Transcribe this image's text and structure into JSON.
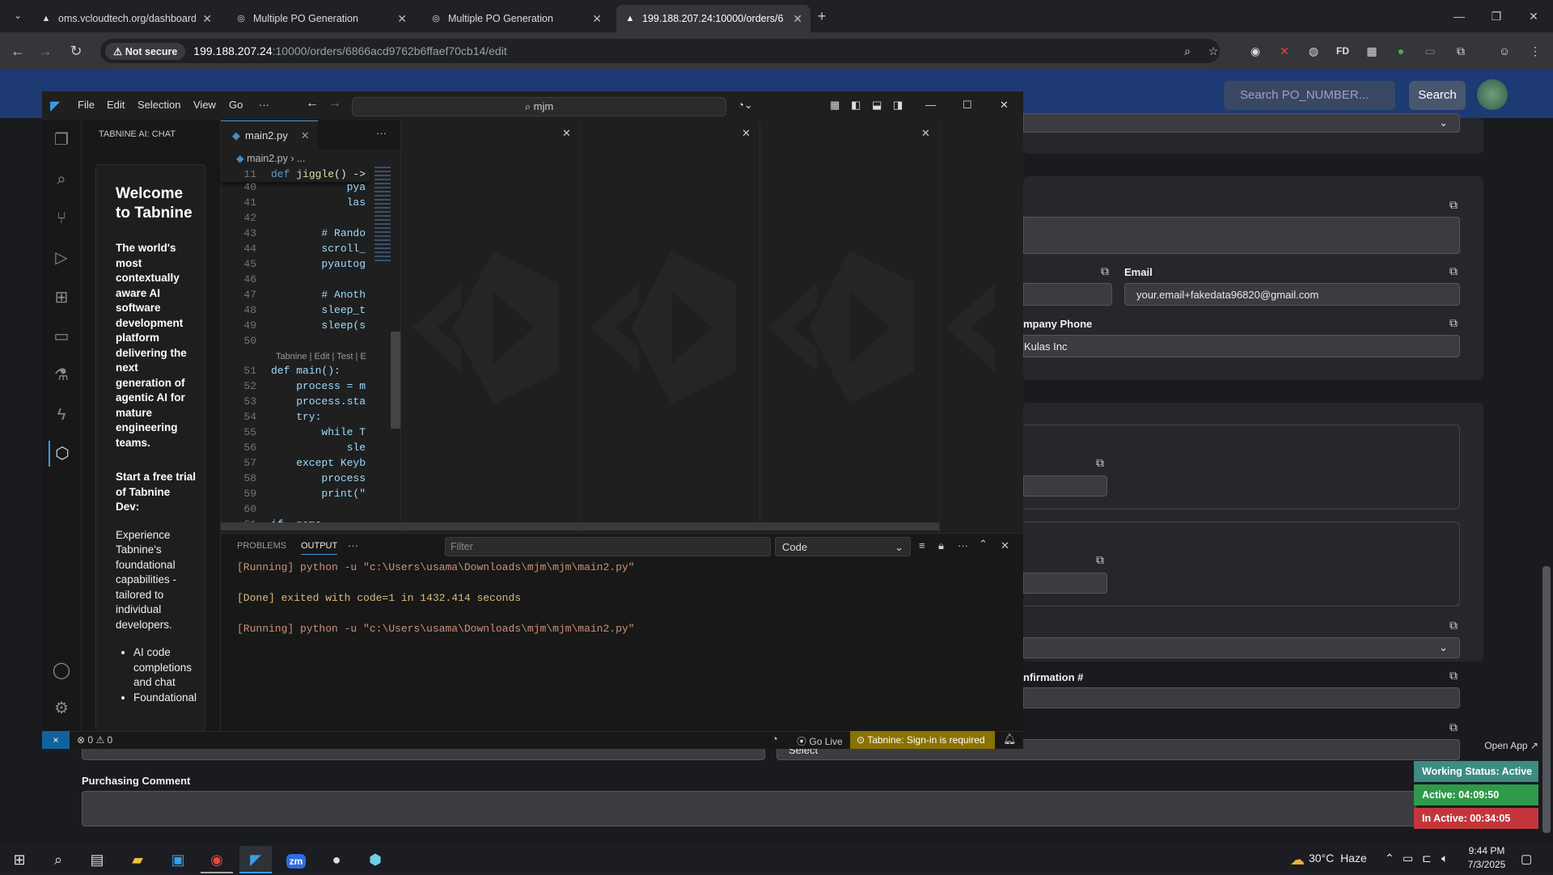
{
  "browser": {
    "tabs": [
      {
        "title": "oms.vcloudtech.org/dashboard",
        "active": false
      },
      {
        "title": "Multiple PO Generation",
        "active": false
      },
      {
        "title": "Multiple PO Generation",
        "active": false
      },
      {
        "title": "199.188.207.24:10000/orders/6",
        "active": true
      }
    ],
    "not_secure": "Not secure",
    "url_host": "199.188.207.24",
    "url_path": ":10000/orders/6866acd9762b6ffaef70cb14/edit"
  },
  "webpage": {
    "search_placeholder": "Search PO_NUMBER...",
    "search_button": "Search",
    "email_label": "Email",
    "email_value": "your.email+fakedata96820@gmail.com",
    "company_phone_label": "mpany Phone",
    "company_value": "Kulas Inc",
    "confirmation_label": "nfirmation #",
    "select_value": "Select",
    "purchasing_comment_label": "Purchasing Comment",
    "open_app": "Open App ↗"
  },
  "tracker": {
    "working_status": "Working Status: Active",
    "active": "Active: 04:09:50",
    "inactive": "In Active: 00:34:05",
    "colors": {
      "working": "#3c8c84",
      "active": "#2f9a4a",
      "inactive": "#c2363b"
    }
  },
  "vscode": {
    "menu": [
      "File",
      "Edit",
      "Selection",
      "View",
      "Go",
      "···"
    ],
    "command_center": "mjm",
    "sidebar_title": "TABNINE AI: CHAT",
    "chat": {
      "heading": "Welcome to Tabnine",
      "intro": "The world's most contextually aware AI software development platform delivering the next generation of agentic AI for mature engineering teams.",
      "trial": "Start a free trial of Tabnine Dev:",
      "experience": "Experience Tabnine's foundational capabilities - tailored to individual developers.",
      "bullets": [
        "AI code completions and chat",
        "Foundational"
      ]
    },
    "editor": {
      "tab": "main2.py",
      "breadcrumb": "main2.py",
      "breadcrumb_more": "...",
      "sticky": {
        "n": "11",
        "text": "def jiggle() ->"
      },
      "lines": [
        {
          "n": "40",
          "text": "            pya"
        },
        {
          "n": "41",
          "text": "            las"
        },
        {
          "n": "42",
          "text": ""
        },
        {
          "n": "43",
          "text": "        # Rando"
        },
        {
          "n": "44",
          "text": "        scroll_"
        },
        {
          "n": "45",
          "text": "        pyautog"
        },
        {
          "n": "46",
          "text": ""
        },
        {
          "n": "47",
          "text": "        # Anoth"
        },
        {
          "n": "48",
          "text": "        sleep_t"
        },
        {
          "n": "49",
          "text": "        sleep(s"
        },
        {
          "n": "50",
          "text": ""
        }
      ],
      "codelens": "Tabnine | Edit | Test | E",
      "lines2": [
        {
          "n": "51",
          "text": "def main():"
        },
        {
          "n": "52",
          "text": "    process = m"
        },
        {
          "n": "53",
          "text": "    process.sta"
        },
        {
          "n": "54",
          "text": "    try:"
        },
        {
          "n": "55",
          "text": "        while T"
        },
        {
          "n": "56",
          "text": "            sle"
        },
        {
          "n": "57",
          "text": "    except Keyb"
        },
        {
          "n": "58",
          "text": "        process"
        },
        {
          "n": "59",
          "text": "        print(\""
        },
        {
          "n": "60",
          "text": ""
        },
        {
          "n": "61",
          "text": "if  name  =="
        }
      ]
    },
    "panel": {
      "tabs": [
        "PROBLEMS",
        "OUTPUT",
        "···"
      ],
      "filter_placeholder": "Filter",
      "channel": "Code",
      "output": [
        "[Running] python -u \"c:\\Users\\usama\\Downloads\\mjm\\mjm\\main2.py\"",
        "",
        "[Done] exited with code=1 in 1432.414 seconds",
        "",
        "[Running] python -u \"c:\\Users\\usama\\Downloads\\mjm\\mjm\\main2.py\""
      ]
    },
    "status": {
      "remote": "×",
      "errors": "0",
      "warnings": "0",
      "go_live": "Go Live",
      "tabnine": "Tabnine: Sign-in is required",
      "tabnine_bg": "#8a7200"
    }
  },
  "taskbar": {
    "temp": "30°C",
    "weather": "Haze",
    "time": "9:44 PM",
    "date": "7/3/2025"
  }
}
